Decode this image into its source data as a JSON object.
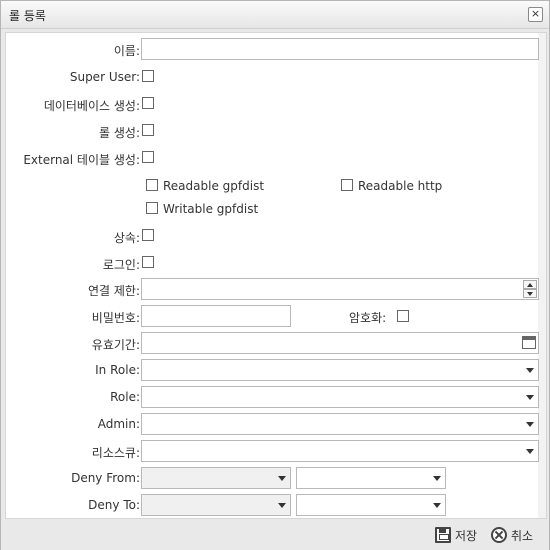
{
  "dialog": {
    "title": "롤 등록",
    "close_glyph": "×"
  },
  "form": {
    "name_label": "이름:",
    "name_value": "",
    "superuser_label": "Super User:",
    "createdb_label": "데이터베이스 생성:",
    "createrole_label": "롤 생성:",
    "exttable_label": "External 테이블 생성:",
    "ext_options": {
      "readable_gpfdist": "Readable gpfdist",
      "readable_http": "Readable http",
      "writable_gpfdist": "Writable gpfdist"
    },
    "inherit_label": "상속:",
    "login_label": "로그인:",
    "connlimit_label": "연결 제한:",
    "connlimit_value": "",
    "password_label": "비밀번호:",
    "password_value": "",
    "encrypted_label": "암호화:",
    "validuntil_label": "유효기간:",
    "validuntil_value": "",
    "inrole_label": "In Role:",
    "role_label": "Role:",
    "admin_label": "Admin:",
    "resqueue_label": "리소스큐:",
    "denyfrom_label": "Deny From:",
    "denyto_label": "Deny To:"
  },
  "footer": {
    "save_label": "저장",
    "cancel_label": "취소"
  },
  "icons": {
    "save": "save-icon",
    "cancel": "cancel-icon",
    "calendar": "calendar-icon",
    "dropdown": "chevron-down-icon"
  }
}
